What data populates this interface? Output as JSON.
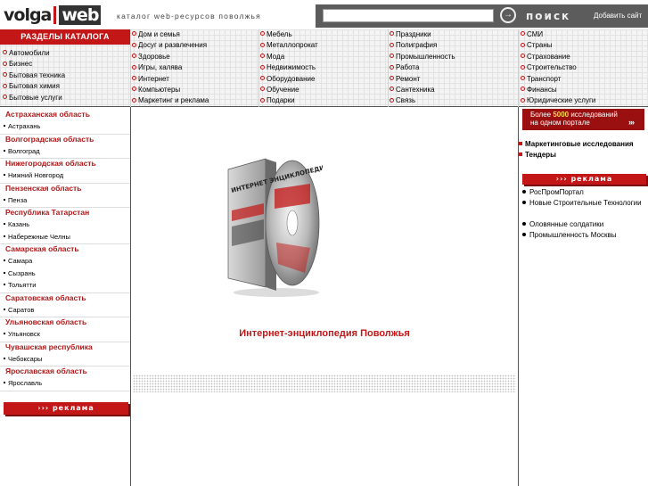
{
  "header": {
    "logo_left": "volga",
    "logo_right": "web",
    "tagline": "каталог web-ресурсов поволжья",
    "search": {
      "value": "",
      "placeholder": ""
    },
    "search_button": "поиск",
    "add_site": "Добавить сайт"
  },
  "catalog": {
    "title": "РАЗДЕЛЫ КАТАЛОГА",
    "col0": [
      "Автомобили",
      "Бизнес",
      "Бытовая техника",
      "Бытовая химия",
      "Бытовые услуги"
    ],
    "col1": [
      "Дом и семья",
      "Досуг и развлечения",
      "Здоровье",
      "Игры, халява",
      "Интернет",
      "Компьютеры",
      "Маркетинг и реклама"
    ],
    "col2": [
      "Мебель",
      "Металлопрокат",
      "Мода",
      "Недвижимость",
      "Оборудование",
      "Обучение",
      "Подарки"
    ],
    "col3": [
      "Праздники",
      "Полиграфия",
      "Промышленность",
      "Работа",
      "Ремонт",
      "Сантехника",
      "Связь"
    ],
    "col4": [
      "СМИ",
      "Страны",
      "Страхование",
      "Строительство",
      "Транспорт",
      "Финансы",
      "Юридические услуги"
    ]
  },
  "regions": [
    {
      "name": "Астраханская область",
      "cities": [
        "Астрахань"
      ]
    },
    {
      "name": "Волгоградская область",
      "cities": [
        "Волгоград"
      ]
    },
    {
      "name": "Нижегородская область",
      "cities": [
        "Нижний Новгород"
      ]
    },
    {
      "name": "Пензенская область",
      "cities": [
        "Пенза"
      ]
    },
    {
      "name": "Республика Татарстан",
      "cities": [
        "Казань",
        "Набережные Челны"
      ]
    },
    {
      "name": "Самарская область",
      "cities": [
        "Самара",
        "Сызрань",
        "Тольятти"
      ]
    },
    {
      "name": "Саратовская область",
      "cities": [
        "Саратов"
      ]
    },
    {
      "name": "Ульяновская область",
      "cities": [
        "Ульяновск"
      ]
    },
    {
      "name": "Чувашская республика",
      "cities": [
        "Чебоксары"
      ]
    },
    {
      "name": "Ярославская область",
      "cities": [
        "Ярославль"
      ]
    }
  ],
  "left_ad": "››› реклама",
  "center": {
    "cd_label": "ИНТЕРНЕТ ЭНЦИКЛОПЕДИЯ",
    "title": "Интернет-энциклопедия Поволжья"
  },
  "right": {
    "banner_pre": "Более ",
    "banner_num": "5000",
    "banner_post": " исследований",
    "banner_line2": "на одном портале",
    "banner_arrows": "›››",
    "links": [
      "Маркетинговые исследования",
      "Тендеры"
    ],
    "ad_title": "››› реклама",
    "ad_items": [
      "РосПромПортал",
      "Новые Строительные Технологии",
      "Оловянные солдатики",
      "Промышленность Москвы"
    ]
  },
  "colors": {
    "accent": "#c31616",
    "dark": "#5c5c5c"
  }
}
